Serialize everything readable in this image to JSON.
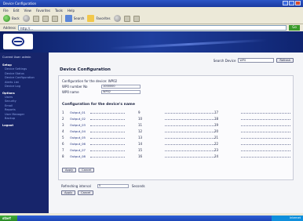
{
  "browser": {
    "title": "Device Configuration",
    "menu": [
      "File",
      "Edit",
      "View",
      "Favorites",
      "Tools",
      "Help"
    ],
    "toolbar": {
      "back_label": "Back",
      "search_label": "Search",
      "favorites_label": "Favorites"
    },
    "address_label": "Address",
    "address_value": "http://...",
    "go_label": "Go"
  },
  "sidebar": {
    "user": "Current User: admin",
    "sections": [
      {
        "head": "Setup",
        "items": [
          "Device Settings",
          "Device Status",
          "Device Configuration",
          "Alerts List",
          "Device Log"
        ]
      },
      {
        "head": "Options",
        "items": [
          "Users",
          "Security",
          "Email",
          "Reports",
          "User Manager",
          "Backup"
        ]
      }
    ],
    "logout": "Logout"
  },
  "search": {
    "label": "Search Device",
    "value": "WP0",
    "button": "Refresh"
  },
  "page": {
    "title": "Device Configuration"
  },
  "config": {
    "device_line": "Configuration for the device: WP02",
    "fields": [
      {
        "label": "WP0 number No",
        "value": "1000000"
      },
      {
        "label": "WP0 name",
        "value": "WP02"
      }
    ],
    "outputs_heading": "Configuration for the device's name",
    "outputs": [
      {
        "num": "1",
        "label": "Output_01"
      },
      {
        "num": "2",
        "label": "Output_02"
      },
      {
        "num": "3",
        "label": "Output_03"
      },
      {
        "num": "4",
        "label": "Output_04"
      },
      {
        "num": "5",
        "label": "Output_05"
      },
      {
        "num": "6",
        "label": "Output_06"
      },
      {
        "num": "7",
        "label": "Output_07"
      },
      {
        "num": "8",
        "label": "Output_08"
      }
    ],
    "col2_nums": [
      "9",
      "10",
      "11",
      "12",
      "13",
      "14",
      "15",
      "16"
    ],
    "col3_nums": [
      "17",
      "18",
      "19",
      "20",
      "21",
      "22",
      "23",
      "24"
    ],
    "apply_label": "Apply",
    "cancel_label": "Cancel"
  },
  "refresh": {
    "label": "Refreshing interval",
    "value": "5",
    "unit": "Seconds",
    "apply_label": "Apply",
    "cancel_label": "Cancel"
  },
  "taskbar": {
    "start_label": "start",
    "tray_label": "Internet"
  }
}
